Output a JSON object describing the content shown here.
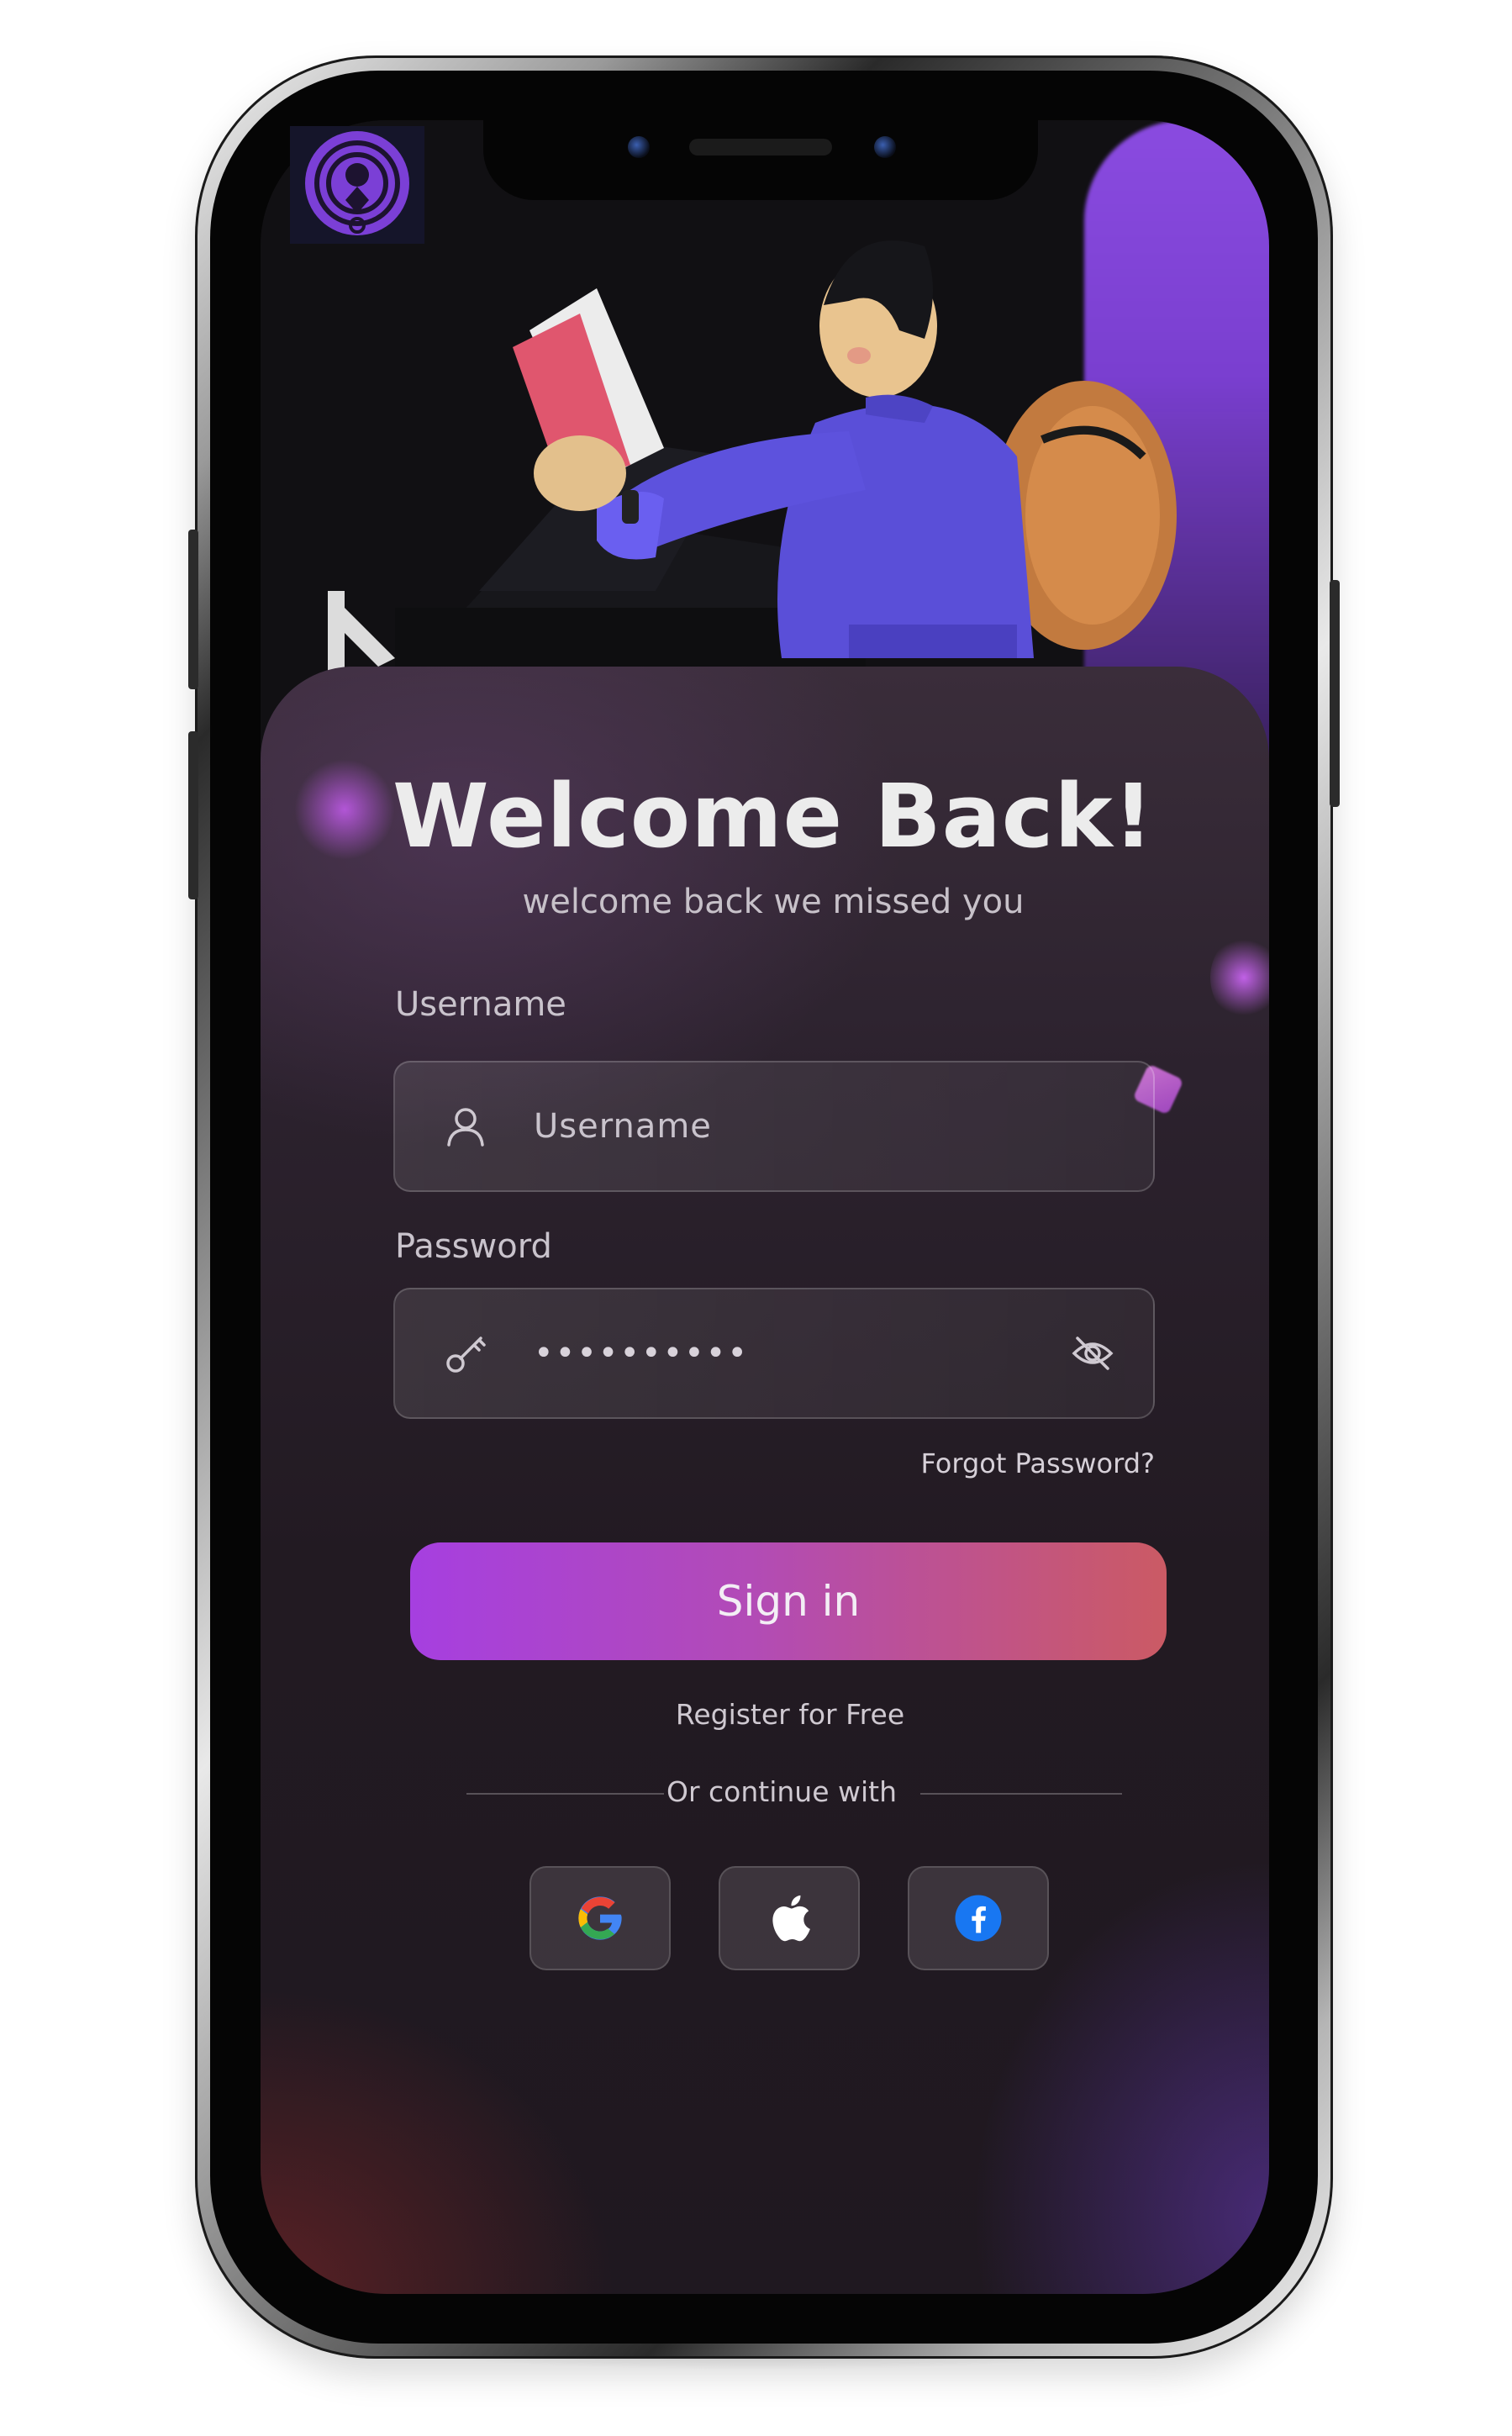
{
  "login": {
    "title": "Welcome Back!",
    "subtitle": "welcome back we missed you",
    "username_label": "Username",
    "username_placeholder": "Username",
    "password_label": "Password",
    "password_value": "••••••••••",
    "forgot_password": "Forgot Password?",
    "sign_in": "Sign in",
    "register": "Register for Free",
    "or_continue": "Or continue with"
  },
  "social": [
    "google-icon",
    "apple-icon",
    "facebook-icon"
  ],
  "colors": {
    "accent_start": "#a63fe0",
    "accent_end": "#cb5a64",
    "background": "#1f1820",
    "text": "#ececec"
  }
}
